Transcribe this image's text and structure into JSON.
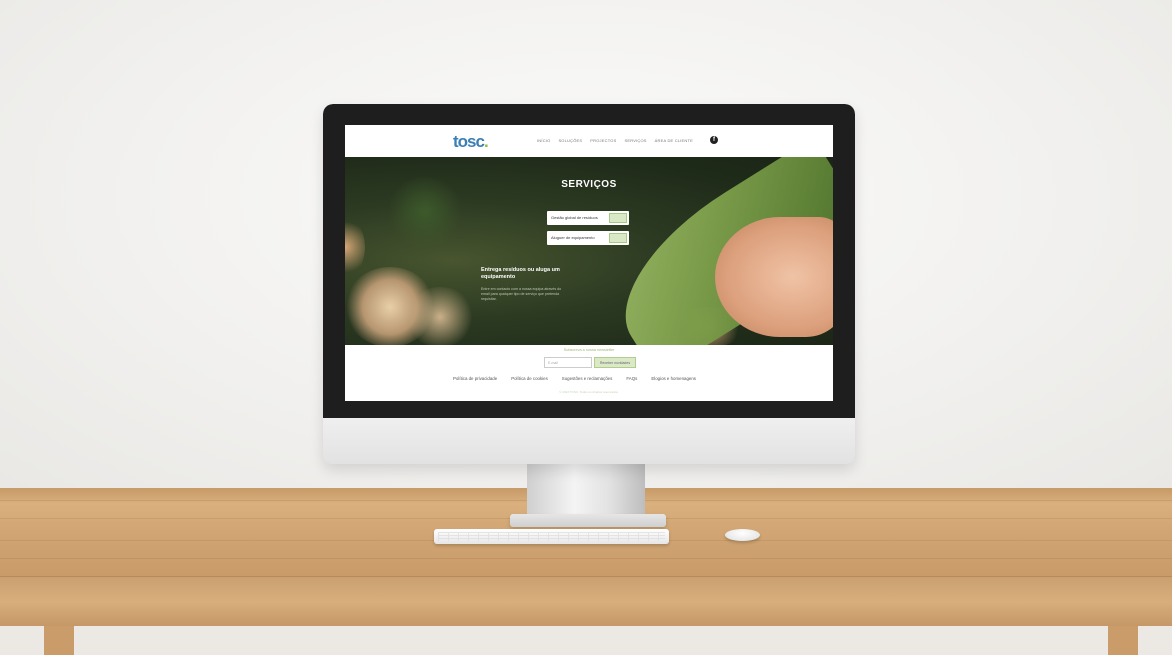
{
  "site": {
    "logo_text": "tosc",
    "nav_items": [
      "INÍCIO",
      "SOLUÇÕES",
      "PROJECTOS",
      "SERVIÇOS",
      "ÁREA DE CLIENTE"
    ],
    "facebook_icon": "facebook-icon",
    "hero": {
      "title": "SERVIÇOS",
      "service_1": "Gestão global de resíduos",
      "service_2": "Aluguer de equipamento",
      "heading": "Entrega resíduos ou aluga um equipamento",
      "paragraph": "Entre em contacto com a nossa equipa através do email para qualquer tipo de serviço que pretenda requisitar."
    },
    "footer": {
      "newsletter_label": "Subscreva a nossa newsletter",
      "email_placeholder": "E-mail",
      "subscribe_label": "Receber novidades",
      "links": [
        "Política de privacidade",
        "Política de cookies",
        "Sugestões e reclamações",
        "FAQs",
        "Elogios e homenagens"
      ],
      "copyright": "© 2022 TOSC. Todos os direitos reservados."
    }
  },
  "colors": {
    "brand_blue": "#3b7fb5",
    "brand_green": "#8bbf3f",
    "desk_wood": "#d2a775"
  }
}
